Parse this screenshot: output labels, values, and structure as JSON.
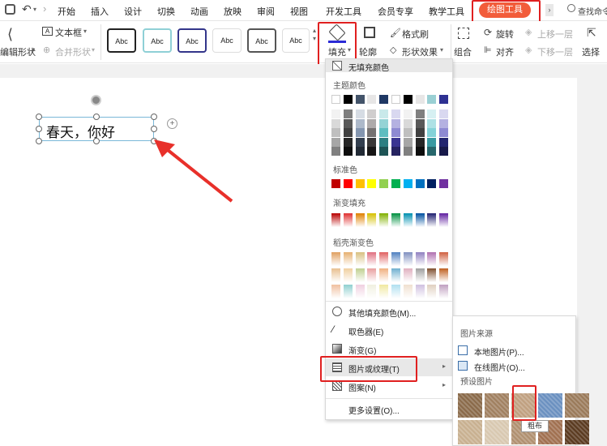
{
  "menubar": {
    "tabs": [
      "开始",
      "插入",
      "设计",
      "切换",
      "动画",
      "放映",
      "审阅",
      "视图",
      "开发工具",
      "会员专享",
      "教学工具"
    ],
    "active_tab": "绘图工具",
    "search_label": "查找命令"
  },
  "ribbon": {
    "edit_shape_label": "编辑形状",
    "textbox_label": "文本框",
    "merge_shape_label": "合并形状",
    "style_samples": [
      "Abc",
      "Abc",
      "Abc",
      "Abc",
      "Abc",
      "Abc"
    ],
    "fill_label": "填充",
    "outline_label": "轮廓",
    "format_painter_label": "格式刷",
    "shape_effect_label": "形状效果",
    "group_label": "组合",
    "rotate_label": "旋转",
    "align_label": "对齐",
    "move_up_label": "上移一层",
    "move_down_label": "下移一层",
    "select_label": "选择"
  },
  "canvas": {
    "textbox_text": "春天，你好"
  },
  "fill_menu": {
    "no_fill": "无填充颜色",
    "theme_colors_title": "主题颜色",
    "standard_colors_title": "标准色",
    "gradient_fill_title": "渐变填充",
    "docer_gradient_title": "稻壳渐变色",
    "more_colors": "其他填充颜色(M)...",
    "eyedropper": "取色器(E)",
    "gradient": "渐变(G)",
    "picture_texture": "图片或纹理(T)",
    "pattern": "图案(N)",
    "more_settings": "更多设置(O)...",
    "theme_row": [
      "#ffffff",
      "#000000",
      "#44546a",
      "#e7e6e6",
      "#1f3864",
      "#ffffff",
      "#000000",
      "#e7e6e6",
      "#9ad0d4",
      "#2e3192"
    ],
    "theme_cols": [
      [
        "#f2f2f2",
        "#d9d9d9",
        "#bfbfbf",
        "#a6a6a6",
        "#808080"
      ],
      [
        "#7f7f7f",
        "#595959",
        "#404040",
        "#262626",
        "#0d0d0d"
      ],
      [
        "#d6dce4",
        "#adb9ca",
        "#8496b0",
        "#333f4f",
        "#222a35"
      ],
      [
        "#d0cece",
        "#aeaaaa",
        "#757171",
        "#3a3838",
        "#171616"
      ],
      [
        "#c9e9ea",
        "#94d3d5",
        "#5ebdc0",
        "#2d7f82",
        "#1e5456"
      ],
      [
        "#d9d8f0",
        "#b4b1e1",
        "#8e8ad2",
        "#3a3591",
        "#262361"
      ],
      [
        "#f2f2f2",
        "#d9d9d9",
        "#bfbfbf",
        "#a6a6a6",
        "#808080"
      ],
      [
        "#7f7f7f",
        "#595959",
        "#404040",
        "#262626",
        "#0d0d0d"
      ],
      [
        "#d6f0f2",
        "#ade1e5",
        "#84d2d8",
        "#3a9aa2",
        "#27676c"
      ],
      [
        "#d9d8f0",
        "#b4b1e1",
        "#8e8ad2",
        "#22256f",
        "#17194a"
      ]
    ],
    "standard_row": [
      "#c00000",
      "#ff0000",
      "#ffc000",
      "#ffff00",
      "#92d050",
      "#00b050",
      "#00b0f0",
      "#0070c0",
      "#002060",
      "#7030a0"
    ],
    "gradient_row": [
      "#b80000",
      "#e03030",
      "#e08000",
      "#d6c000",
      "#80b000",
      "#009040",
      "#0090b0",
      "#0050a0",
      "#202070",
      "#6020a0"
    ],
    "docer_rows": [
      [
        "#e0a060",
        "#e6b070",
        "#d8c080",
        "#e07080",
        "#e06060",
        "#5080c0",
        "#8090c0",
        "#9080c0",
        "#b070b0",
        "#d06040"
      ],
      [
        "#e8c090",
        "#f0d0a0",
        "#c0d090",
        "#e8a0a0",
        "#f0b080",
        "#70b0d0",
        "#e0b0c0",
        "#a0a0a0",
        "#805030",
        "#c06020"
      ],
      [
        "#f0c0a0",
        "#90d0d0",
        "#f0d0e0",
        "#f0f0e0",
        "#f0e8a0",
        "#b0e0f0",
        "#f0e0d0",
        "#d0c0e0",
        "#e0d0c0",
        "#c0a0c0"
      ]
    ]
  },
  "sub_menu": {
    "source_title": "图片来源",
    "local_picture": "本地图片(P)...",
    "online_picture": "在线图片(O)...",
    "preset_title": "预设图片",
    "tooltip": "粗布",
    "textures": [
      "#8a6a4a",
      "#a08060",
      "#c0a080",
      "#6a90c0",
      "#9a7a5a",
      "#c8b090",
      "#d8c8b0",
      "#b09070",
      "#a07050",
      "#5a3a20"
    ]
  }
}
